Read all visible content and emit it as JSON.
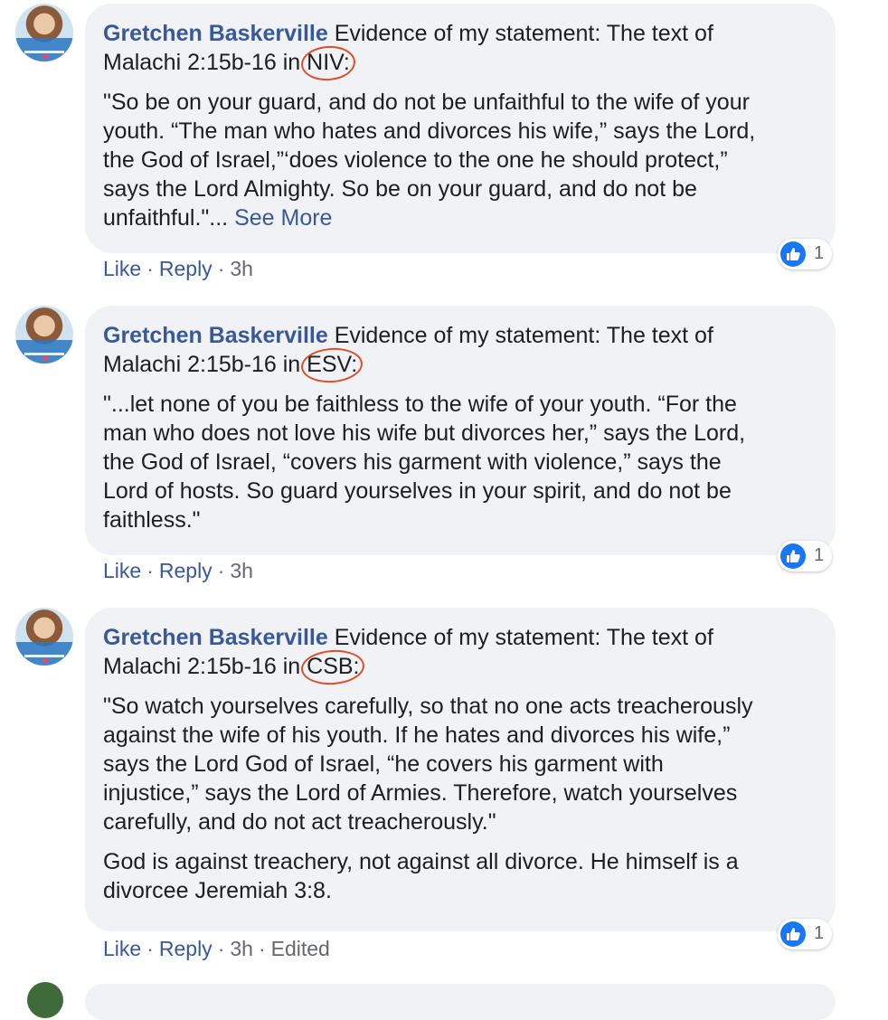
{
  "comments": [
    {
      "author": "Gretchen Baskerville",
      "intro_rest": " Evidence of my statement: The text of",
      "line2_prefix": "Malachi 2:15b-16 in ",
      "version": "NIV",
      "version_suffix": ":",
      "quote_lines": [
        "\"So be on your guard, and do not be unfaithful to the wife of your",
        "youth. “The man who hates and divorces his wife,” says the Lord,",
        "the God of Israel,”‘does violence to the one he should protect,”",
        "says the Lord Almighty. So be on your guard, and do not be"
      ],
      "last_quote_line": "unfaithful.\"... ",
      "see_more": "See More",
      "extra_lines": [],
      "reaction_count": "1",
      "actions": {
        "like": "Like",
        "reply": "Reply",
        "time": "3h",
        "edited": ""
      }
    },
    {
      "author": "Gretchen Baskerville",
      "intro_rest": " Evidence of my statement: The text of",
      "line2_prefix": "Malachi 2:15b-16 in ",
      "version": "ESV",
      "version_suffix": ":",
      "quote_lines": [
        "\"...let none of you be faithless to the wife of your youth. “For the",
        "man who does not love his wife but divorces her,” says the Lord,",
        "the God of Israel, “covers his garment with violence,” says the",
        "Lord of hosts. So guard yourselves in your spirit, and do not be",
        "faithless.\""
      ],
      "last_quote_line": "",
      "see_more": "",
      "extra_lines": [],
      "reaction_count": "1",
      "actions": {
        "like": "Like",
        "reply": "Reply",
        "time": "3h",
        "edited": ""
      }
    },
    {
      "author": "Gretchen Baskerville",
      "intro_rest": " Evidence of my statement: The text of",
      "line2_prefix": "Malachi 2:15b-16 in ",
      "version": "CSB",
      "version_suffix": ":",
      "quote_lines": [
        "\"So watch yourselves carefully, so that no one acts treacherously",
        "against the wife of his youth. If he hates and divorces his wife,”",
        "says the Lord God of Israel, “he covers his garment with",
        "injustice,” says the Lord of Armies. Therefore, watch yourselves",
        "carefully, and do not act treacherously.\""
      ],
      "last_quote_line": "",
      "see_more": "",
      "extra_lines": [
        "God is against treachery, not against all divorce. He himself is a",
        "divorcee Jeremiah 3:8."
      ],
      "reaction_count": "1",
      "actions": {
        "like": "Like",
        "reply": "Reply",
        "time": "3h",
        "edited": "Edited"
      }
    }
  ],
  "colors": {
    "author": "#385898",
    "bubble": "#f0f2f5",
    "annotation_ring": "#d9512c",
    "like_badge": "#1877f2",
    "meta": "#65676b"
  },
  "icons": {
    "avatar": "profile-photo",
    "reaction": "thumbs-up-icon"
  }
}
